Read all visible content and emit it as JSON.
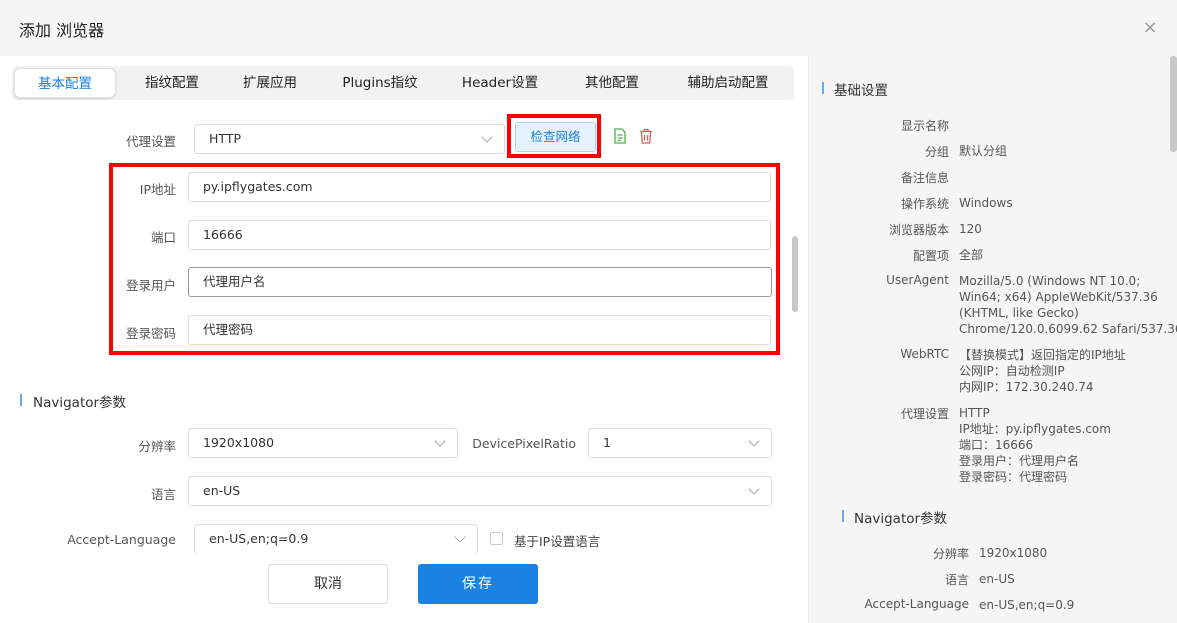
{
  "dialog": {
    "title": "添加 浏览器",
    "close_glyph": "×"
  },
  "tabs": [
    "基本配置",
    "指纹配置",
    "扩展应用",
    "Plugins指纹",
    "Header设置",
    "其他配置",
    "辅助启动配置"
  ],
  "proxy": {
    "label": "代理设置",
    "type": "HTTP",
    "check_button": "检查网络",
    "ip_label": "IP地址",
    "ip_value": "py.ipflygates.com",
    "port_label": "端口",
    "port_value": "16666",
    "user_label": "登录用户",
    "user_value": "代理用户名",
    "pass_label": "登录密码",
    "pass_value": "代理密码"
  },
  "navigator": {
    "title": "Navigator参数",
    "resolution_label": "分辨率",
    "resolution_value": "1920x1080",
    "dpr_label": "DevicePixelRatio",
    "dpr_value": "1",
    "lang_label": "语言",
    "lang_value": "en-US",
    "accept_lang_label": "Accept-Language",
    "accept_lang_value": "en-US,en;q=0.9",
    "ip_lang_checkbox": "基于IP设置语言"
  },
  "footer": {
    "cancel": "取消",
    "save": "保存"
  },
  "summary": {
    "basic_title": "基础设置",
    "display_name_label": "显示名称",
    "group_label": "分组",
    "group_value": "默认分组",
    "remark_label": "备注信息",
    "os_label": "操作系统",
    "os_value": "Windows",
    "browser_ver_label": "浏览器版本",
    "browser_ver_value": "120",
    "config_label": "配置项",
    "config_value": "全部",
    "ua_label": "UserAgent",
    "ua_lines": [
      "Mozilla/5.0 (Windows NT 10.0;",
      "Win64; x64) AppleWebKit/537.36",
      "(KHTML, like Gecko)",
      "Chrome/120.0.6099.62 Safari/537.36"
    ],
    "webrtc_label": "WebRTC",
    "webrtc_lines": [
      "【替换模式】返回指定的IP地址",
      "公网IP：自动检测IP",
      "内网IP：172.30.240.74"
    ],
    "proxy_label": "代理设置",
    "proxy_lines": [
      "HTTP",
      "IP地址：py.ipflygates.com",
      "端口：16666",
      "登录用户：代理用户名",
      "登录密码：代理密码"
    ],
    "nav_title": "Navigator参数",
    "res_label": "分辨率",
    "res_value": "1920x1080",
    "lang_label": "语言",
    "lang_value": "en-US",
    "accept_label": "Accept-Language",
    "accept_value": "en-US,en;q=0.9"
  },
  "colors": {
    "accent": "#1a82e0",
    "highlight": "#ff0000",
    "panel_bg": "#f5f5f5"
  }
}
